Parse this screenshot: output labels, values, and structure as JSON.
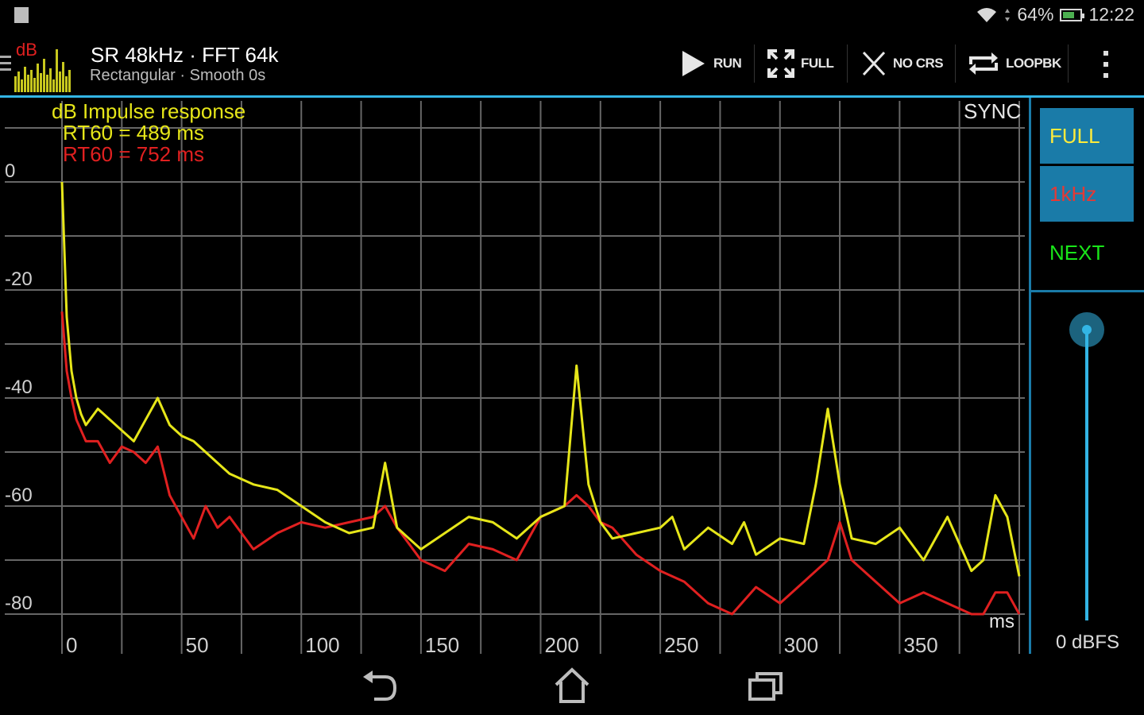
{
  "status": {
    "battery": "64%",
    "time": "12:22"
  },
  "actionbar": {
    "logo_text": "dB",
    "title": "SR 48kHz · FFT 64k",
    "subtitle": "Rectangular · Smooth 0s",
    "run_label": "RUN",
    "full_label": "FULL",
    "nocrs_label": "NO CRS",
    "loopbk_label": "LOOPBK"
  },
  "plot": {
    "title": "dB Impulse response",
    "rt60_yellow": "RT60 = 489 ms",
    "rt60_red": "RT60 = 752 ms",
    "sync_label": "SYNC",
    "x_unit": "ms",
    "colors": {
      "yellow": "#e6e619",
      "red": "#e02020",
      "title": "#e6e619",
      "grid": "#666666"
    }
  },
  "side": {
    "full_label": "FULL",
    "khz_label": "1kHz",
    "next_label": "NEXT",
    "level_label": "0 dBFS"
  },
  "chart_data": {
    "type": "line",
    "xlim": [
      0,
      400
    ],
    "ylim": [
      -85,
      10
    ],
    "x_ticks": [
      0,
      50,
      100,
      150,
      200,
      250,
      300,
      350
    ],
    "y_ticks": [
      0,
      -20,
      -40,
      -60,
      -80
    ],
    "series": [
      {
        "color": "#e6e619",
        "x": [
          0,
          2,
          4,
          6,
          8,
          10,
          15,
          20,
          25,
          30,
          35,
          40,
          45,
          50,
          55,
          60,
          65,
          70,
          75,
          80,
          90,
          100,
          110,
          120,
          130,
          135,
          140,
          145,
          150,
          160,
          170,
          180,
          190,
          200,
          210,
          215,
          220,
          225,
          230,
          240,
          250,
          255,
          260,
          270,
          280,
          285,
          290,
          300,
          310,
          315,
          320,
          325,
          330,
          340,
          350,
          360,
          370,
          380,
          385,
          390,
          395,
          400
        ],
        "y": [
          0,
          -25,
          -35,
          -40,
          -43,
          -45,
          -42,
          -44,
          -46,
          -48,
          -44,
          -40,
          -45,
          -47,
          -48,
          -50,
          -52,
          -54,
          -55,
          -56,
          -57,
          -60,
          -63,
          -65,
          -64,
          -52,
          -64,
          -66,
          -68,
          -65,
          -62,
          -63,
          -66,
          -62,
          -60,
          -34,
          -56,
          -63,
          -66,
          -65,
          -64,
          -62,
          -68,
          -64,
          -67,
          -63,
          -69,
          -66,
          -67,
          -56,
          -42,
          -56,
          -66,
          -67,
          -64,
          -70,
          -62,
          -72,
          -70,
          -58,
          -62,
          -73
        ]
      },
      {
        "color": "#e02020",
        "x": [
          0,
          2,
          4,
          6,
          8,
          10,
          15,
          20,
          25,
          30,
          35,
          40,
          45,
          50,
          55,
          60,
          65,
          70,
          75,
          80,
          90,
          100,
          110,
          120,
          130,
          135,
          140,
          150,
          160,
          170,
          180,
          190,
          200,
          210,
          215,
          220,
          225,
          230,
          240,
          250,
          260,
          270,
          280,
          290,
          300,
          310,
          320,
          325,
          330,
          340,
          350,
          360,
          370,
          380,
          385,
          390,
          395,
          400
        ],
        "y": [
          -24,
          -35,
          -40,
          -44,
          -46,
          -48,
          -48,
          -52,
          -49,
          -50,
          -52,
          -49,
          -58,
          -62,
          -66,
          -60,
          -64,
          -62,
          -65,
          -68,
          -65,
          -63,
          -64,
          -63,
          -62,
          -60,
          -64,
          -70,
          -72,
          -67,
          -68,
          -70,
          -62,
          -60,
          -58,
          -60,
          -63,
          -64,
          -69,
          -72,
          -74,
          -78,
          -80,
          -75,
          -78,
          -74,
          -70,
          -63,
          -70,
          -74,
          -78,
          -76,
          -78,
          -80,
          -80,
          -76,
          -76,
          -80
        ]
      }
    ]
  }
}
